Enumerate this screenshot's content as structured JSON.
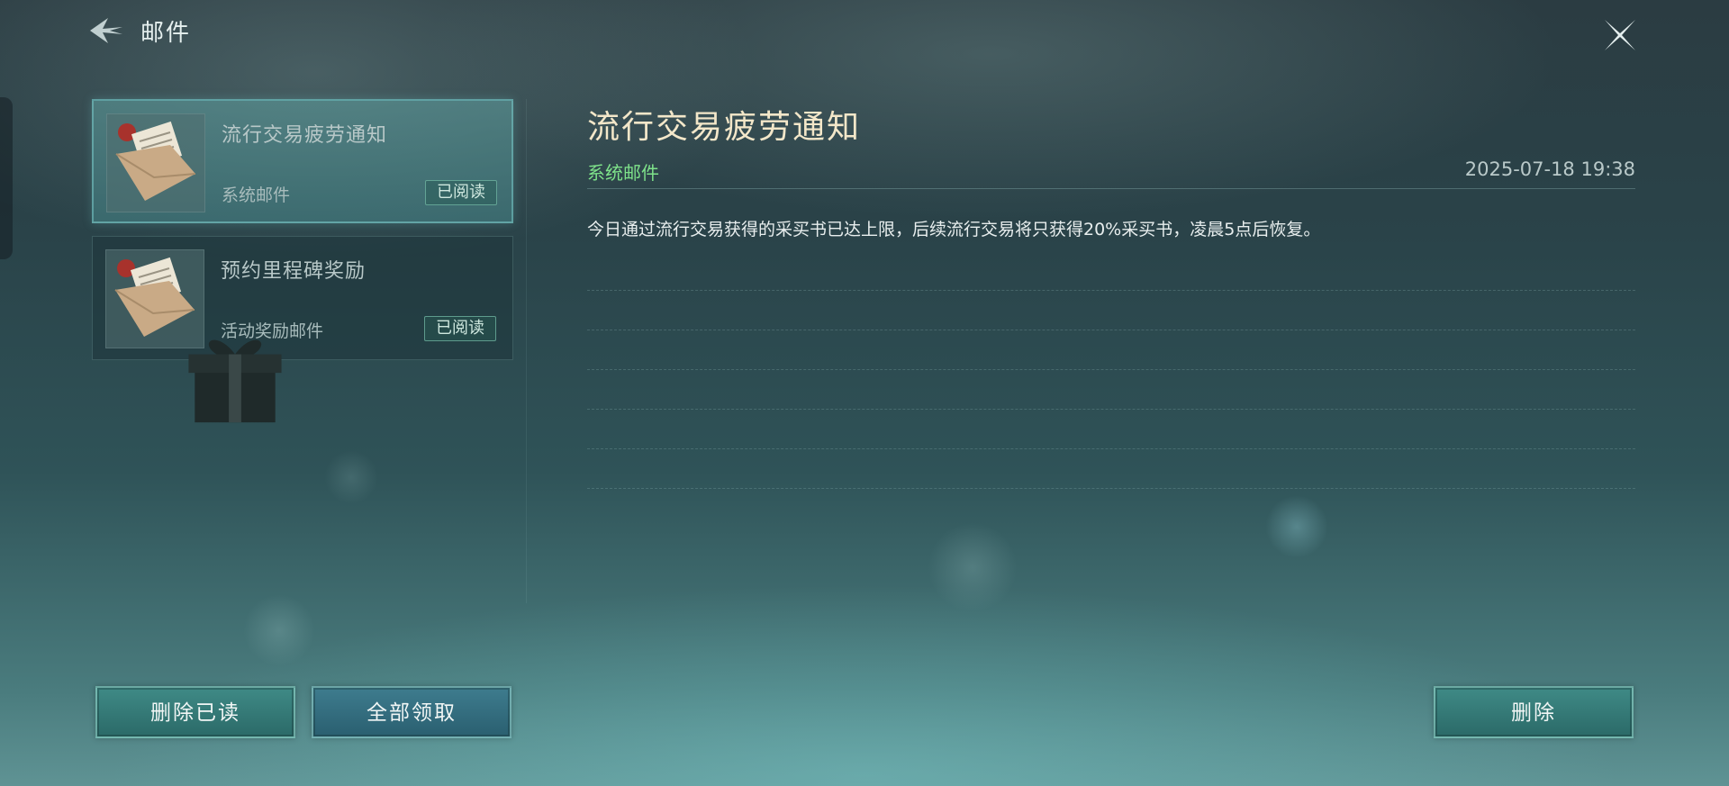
{
  "header": {
    "title": "邮件"
  },
  "mails": [
    {
      "subject": "流行交易疲劳通知",
      "type": "系统邮件",
      "status": "已阅读",
      "selected": true
    },
    {
      "subject": "预约里程碑奖励",
      "type": "活动奖励邮件",
      "status": "已阅读",
      "selected": false
    }
  ],
  "detail": {
    "title": "流行交易疲劳通知",
    "type": "系统邮件",
    "time": "2025-07-18 19:38",
    "body": "今日通过流行交易获得的采买书已达上限，后续流行交易将只获得20%采买书，凌晨5点后恢复。"
  },
  "buttons": {
    "delete_read": "删除已读",
    "claim_all": "全部领取",
    "delete": "删除"
  },
  "icons": {
    "back": "back-arrow-icon",
    "close": "close-icon",
    "envelope": "envelope-icon",
    "gift": "gift-icon"
  },
  "colors": {
    "detail_title": "#f3e7c9",
    "mail_type_green": "#7ee28a",
    "button_teal": "#2b6a68"
  }
}
